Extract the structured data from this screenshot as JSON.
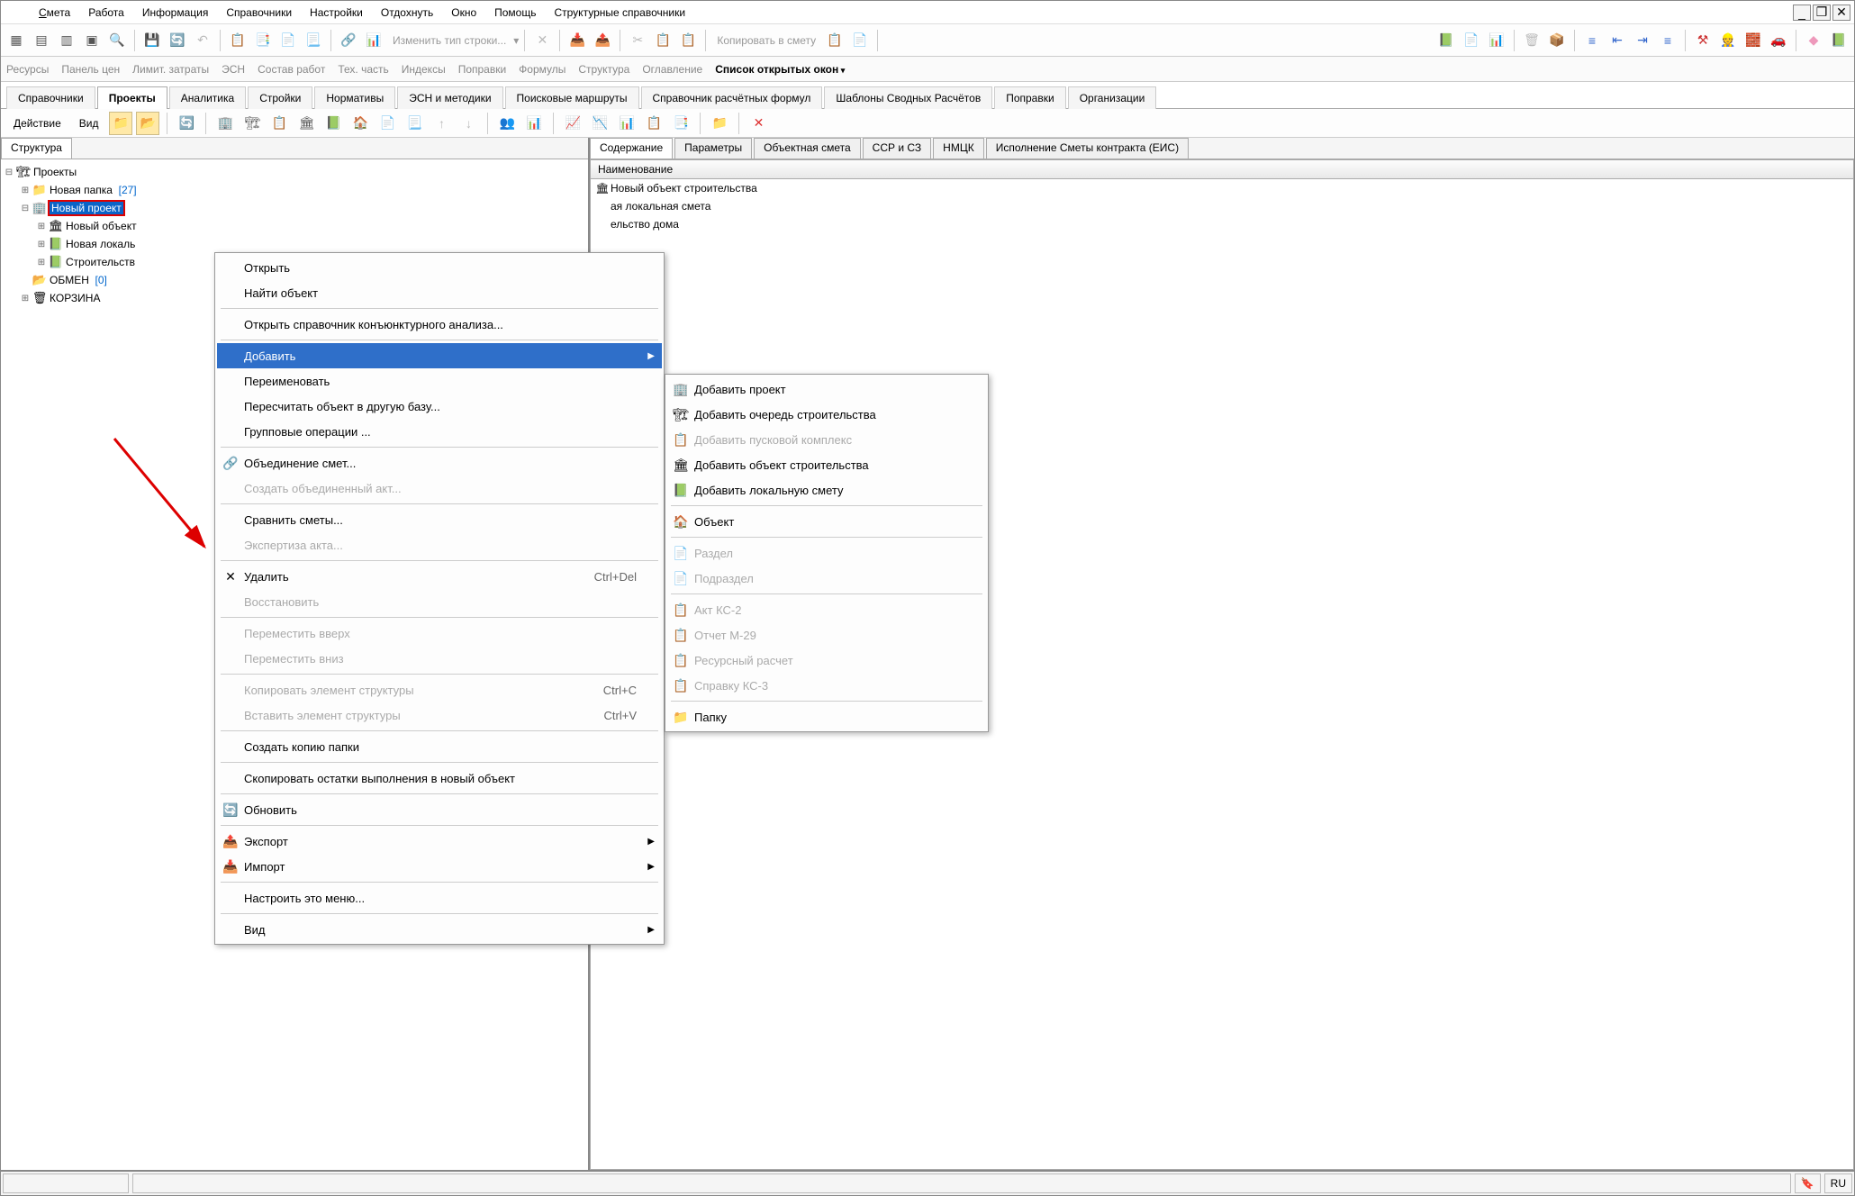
{
  "menubar": {
    "items": [
      "Смета",
      "Работа",
      "Информация",
      "Справочники",
      "Настройки",
      "Отдохнуть",
      "Окно",
      "Помощь",
      "Структурные справочники"
    ]
  },
  "toolbar_text": {
    "change_type": "Изменить тип строки...",
    "copy_to": "Копировать в смету"
  },
  "secondary": {
    "items": [
      "Ресурсы",
      "Панель цен",
      "Лимит. затраты",
      "ЭСН",
      "Состав работ",
      "Тех. часть",
      "Индексы",
      "Поправки",
      "Формулы",
      "Структура",
      "Оглавление",
      "Список открытых окон"
    ],
    "active_index": 11
  },
  "maintabs": {
    "items": [
      "Справочники",
      "Проекты",
      "Аналитика",
      "Стройки",
      "Нормативы",
      "ЭСН и методики",
      "Поисковые маршруты",
      "Справочник расчётных формул",
      "Шаблоны Сводных Расчётов",
      "Поправки",
      "Организации"
    ],
    "active_index": 1
  },
  "actionbar": {
    "action": "Действие",
    "view": "Вид"
  },
  "left_pane": {
    "tab": "Структура",
    "tree": {
      "root": "Проекты",
      "new_folder": "Новая папка",
      "new_folder_count": "[27]",
      "new_project": "Новый проект",
      "child1": "Новый объект",
      "child2": "Новая локаль",
      "child3": "Строительств",
      "obmen": "ОБМЕН",
      "obmen_count": "[0]",
      "trash": "КОРЗИНА"
    }
  },
  "right_pane": {
    "tabs": [
      "Содержание",
      "Параметры",
      "Объектная смета",
      "ССР и СЗ",
      "НМЦК",
      "Исполнение Сметы контракта (ЕИС)"
    ],
    "active_tab": 0,
    "header": "Наименование",
    "rows": [
      "Новый объект строительства",
      "ая локальная смета",
      "ельство дома"
    ]
  },
  "context_menu": {
    "items": [
      {
        "label": "Открыть",
        "type": "item"
      },
      {
        "label": "Найти объект",
        "type": "item"
      },
      {
        "type": "sep"
      },
      {
        "label": "Открыть справочник конъюнктурного анализа...",
        "type": "item"
      },
      {
        "type": "sep"
      },
      {
        "label": "Добавить",
        "type": "item",
        "highlighted": true,
        "arrow": true
      },
      {
        "label": "Переименовать",
        "type": "item"
      },
      {
        "label": "Пересчитать объект в другую базу...",
        "type": "item"
      },
      {
        "label": "Групповые операции ...",
        "type": "item"
      },
      {
        "type": "sep"
      },
      {
        "label": "Объединение смет...",
        "type": "item",
        "icon": "🔗"
      },
      {
        "label": "Создать объединенный акт...",
        "type": "item",
        "disabled": true
      },
      {
        "type": "sep"
      },
      {
        "label": "Сравнить сметы...",
        "type": "item"
      },
      {
        "label": "Экспертиза акта...",
        "type": "item",
        "disabled": true
      },
      {
        "type": "sep"
      },
      {
        "label": "Удалить",
        "type": "item",
        "icon": "✕",
        "shortcut": "Ctrl+Del"
      },
      {
        "label": "Восстановить",
        "type": "item",
        "disabled": true
      },
      {
        "type": "sep"
      },
      {
        "label": "Переместить вверх",
        "type": "item",
        "disabled": true
      },
      {
        "label": "Переместить вниз",
        "type": "item",
        "disabled": true
      },
      {
        "type": "sep"
      },
      {
        "label": "Копировать элемент структуры",
        "type": "item",
        "disabled": true,
        "shortcut": "Ctrl+C"
      },
      {
        "label": "Вставить элемент структуры",
        "type": "item",
        "disabled": true,
        "shortcut": "Ctrl+V"
      },
      {
        "type": "sep"
      },
      {
        "label": "Создать копию папки",
        "type": "item"
      },
      {
        "type": "sep"
      },
      {
        "label": "Скопировать остатки выполнения в новый объект",
        "type": "item"
      },
      {
        "type": "sep"
      },
      {
        "label": "Обновить",
        "type": "item",
        "icon": "🔄"
      },
      {
        "type": "sep"
      },
      {
        "label": "Экспорт",
        "type": "item",
        "icon": "📤",
        "arrow": true
      },
      {
        "label": "Импорт",
        "type": "item",
        "icon": "📥",
        "arrow": true
      },
      {
        "type": "sep"
      },
      {
        "label": "Настроить это меню...",
        "type": "item"
      },
      {
        "type": "sep"
      },
      {
        "label": "Вид",
        "type": "item",
        "arrow": true
      }
    ]
  },
  "submenu": {
    "items": [
      {
        "label": "Добавить проект",
        "icon": "🏢"
      },
      {
        "label": "Добавить очередь строительства",
        "icon": "🏗"
      },
      {
        "label": "Добавить пусковой комплекс",
        "icon": "📋",
        "disabled": true
      },
      {
        "label": "Добавить объект строительства",
        "icon": "🏛"
      },
      {
        "label": "Добавить локальную смету",
        "icon": "📗"
      },
      {
        "type": "sep"
      },
      {
        "label": "Объект",
        "icon": "🏠"
      },
      {
        "type": "sep"
      },
      {
        "label": "Раздел",
        "icon": "📄",
        "disabled": true
      },
      {
        "label": "Подраздел",
        "icon": "📄",
        "disabled": true
      },
      {
        "type": "sep"
      },
      {
        "label": "Акт КС-2",
        "icon": "📋",
        "disabled": true
      },
      {
        "label": "Отчет М-29",
        "icon": "📋",
        "disabled": true
      },
      {
        "label": "Ресурсный расчет",
        "icon": "📋",
        "disabled": true
      },
      {
        "label": "Справку КС-3",
        "icon": "📋",
        "disabled": true
      },
      {
        "type": "sep"
      },
      {
        "label": "Папку",
        "icon": "📁"
      }
    ]
  },
  "status": {
    "lang": "RU"
  }
}
